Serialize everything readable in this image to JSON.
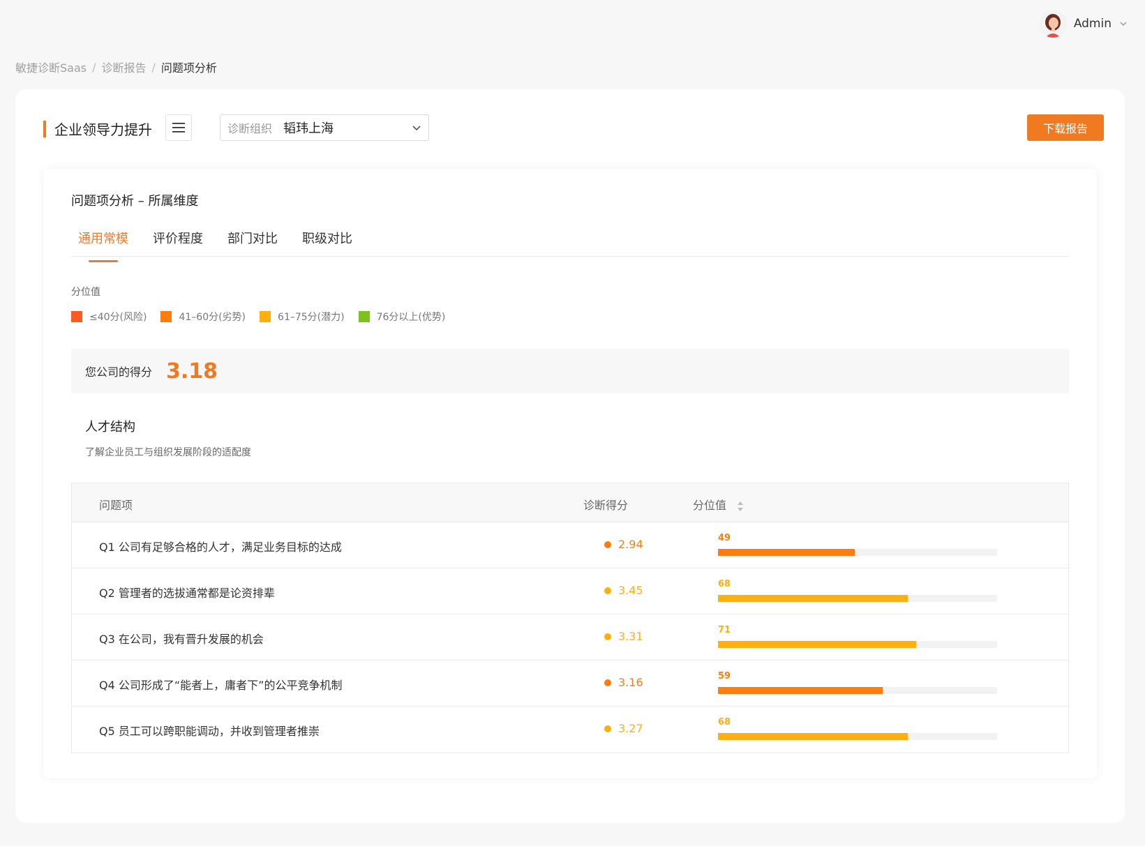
{
  "user": {
    "name": "Admin"
  },
  "breadcrumb": [
    {
      "label": "敏捷诊断Saas"
    },
    {
      "label": "诊断报告"
    },
    {
      "label": "问题项分析"
    }
  ],
  "header": {
    "title": "企业领导力提升",
    "select_label": "诊断组织",
    "select_value": "韬玮上海",
    "download_label": "下载报告"
  },
  "card": {
    "title": "问题项分析 – 所属维度",
    "tabs": [
      {
        "label": "通用常模",
        "active": true
      },
      {
        "label": "评价程度",
        "active": false
      },
      {
        "label": "部门对比",
        "active": false
      },
      {
        "label": "职级对比",
        "active": false
      }
    ]
  },
  "legend": {
    "title": "分位值",
    "items": [
      {
        "label": "≤40分(风险)",
        "color": "#ff5a1f"
      },
      {
        "label": "41–60分(劣势)",
        "color": "#ff7d0f"
      },
      {
        "label": "61–75分(潜力)",
        "color": "#ffb00f"
      },
      {
        "label": "76分以上(优势)",
        "color": "#7cc31b"
      }
    ]
  },
  "score": {
    "label": "您公司的得分",
    "value": "3.18"
  },
  "section": {
    "title": "人才结构",
    "desc": "了解企业员工与组织发展阶段的适配度"
  },
  "table": {
    "headers": {
      "item": "问题项",
      "score": "诊断得分",
      "percentile": "分位值"
    },
    "rows": [
      {
        "text": "Q1 公司有足够合格的人才，满足业务目标的达成",
        "score": "2.94",
        "percentile": 49,
        "color": "#ff7d0f"
      },
      {
        "text": "Q2 管理者的选拔通常都是论资排辈",
        "score": "3.45",
        "percentile": 68,
        "color": "#ffb00f"
      },
      {
        "text": "Q3 在公司，我有晋升发展的机会",
        "score": "3.31",
        "percentile": 71,
        "color": "#ffb00f"
      },
      {
        "text": "Q4 公司形成了“能者上，庸者下”的公平竞争机制",
        "score": "3.16",
        "percentile": 59,
        "color": "#ff7d0f"
      },
      {
        "text": "Q5 员工可以跨职能调动，并收到管理者推崇",
        "score": "3.27",
        "percentile": 68,
        "color": "#ffb00f"
      }
    ]
  }
}
